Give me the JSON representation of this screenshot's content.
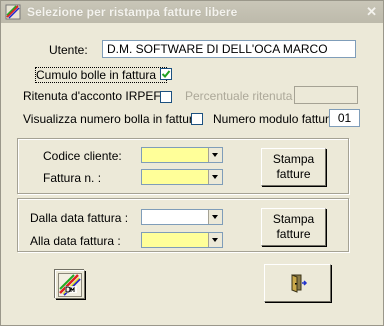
{
  "window": {
    "title": "Selezione per ristampa fatture libere",
    "close_glyph": "✕"
  },
  "utente": {
    "label": "Utente:",
    "value": "D.M. SOFTWARE DI DELL'OCA MARCO"
  },
  "cumulo": {
    "label": "Cumulo bolle in fattura ?",
    "checked": true
  },
  "ritenuta": {
    "label": "Ritenuta d'acconto IRPEF?",
    "checked": false,
    "percent_label": "Percentuale ritenuta",
    "percent_value": ""
  },
  "visualizza": {
    "label": "Visualizza numero bolla in fattura",
    "checked": false
  },
  "modulo": {
    "label": "Numero modulo fattura:",
    "value": "01"
  },
  "group1": {
    "codice_label": "Codice cliente:",
    "fattura_label": "Fattura n. :",
    "stampa_line1": "Stampa",
    "stampa_line2": "fatture"
  },
  "group2": {
    "dalla_label": "Dalla data fattura :",
    "alla_label": "Alla data fattura :",
    "stampa_line1": "Stampa",
    "stampa_line2": "fatture"
  },
  "icons": {
    "logo": "dm-logo-icon",
    "exit": "exit-door-icon"
  },
  "colors": {
    "combo_highlight": "#ffff99",
    "window_bg": "#ece9d8"
  }
}
